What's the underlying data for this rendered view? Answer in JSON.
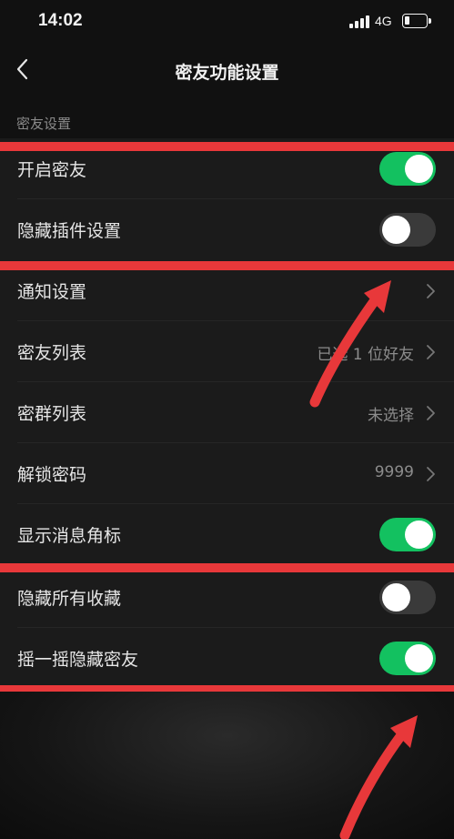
{
  "status_bar": {
    "time": "14:02",
    "network": "4G"
  },
  "nav": {
    "title": "密友功能设置"
  },
  "section_header": "密友设置",
  "rows": [
    {
      "label": "开启密友",
      "toggle": "on"
    },
    {
      "label": "隐藏插件设置",
      "toggle": "off"
    },
    {
      "label": "通知设置",
      "value": ""
    },
    {
      "label": "密友列表",
      "value": "已选 1 位好友"
    },
    {
      "label": "密群列表",
      "value": "未选择"
    },
    {
      "label": "解锁密码",
      "value": "9999"
    },
    {
      "label": "显示消息角标",
      "toggle": "on"
    },
    {
      "label": "隐藏所有收藏",
      "toggle": "off"
    },
    {
      "label": "摇一摇隐藏密友",
      "toggle": "on"
    }
  ],
  "colors": {
    "background": "#111111",
    "row_background": "#1b1b1b",
    "toggle_on": "#13c160",
    "toggle_off": "#3a3a3a",
    "annotation_red": "#e8383a"
  }
}
